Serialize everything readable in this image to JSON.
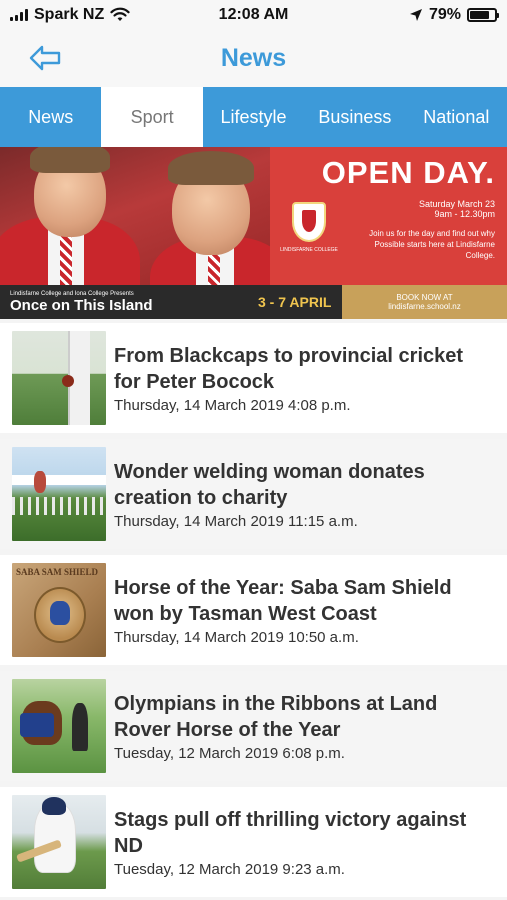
{
  "status_bar": {
    "carrier": "Spark NZ",
    "time": "12:08 AM",
    "battery_percent": "79%",
    "battery_level": 0.79
  },
  "header": {
    "title": "News",
    "back_icon": "back-arrow-icon"
  },
  "tabs": [
    {
      "label": "News",
      "active": false
    },
    {
      "label": "Sport",
      "active": true
    },
    {
      "label": "Lifestyle",
      "active": false
    },
    {
      "label": "Business",
      "active": false
    },
    {
      "label": "National",
      "active": false
    }
  ],
  "banner": {
    "headline": "OPEN DAY.",
    "date": "Saturday March 23",
    "time": "9am - 12.30pm",
    "text": "Join us for the day and find out why Possible starts here at Lindisfarne College.",
    "crest_text": "LINDISFARNE COLLEGE",
    "presenter_line": "Lindisfarne College and Iona College Presents",
    "show_title": "Once on This Island",
    "show_dates": "3 - 7 APRIL",
    "book_label": "BOOK NOW AT",
    "book_url": "lindisfarne.school.nz"
  },
  "articles": [
    {
      "title": "From Blackcaps to provincial cricket for Peter Bocock",
      "date": "Thursday, 14 March 2019 4:08 p.m.",
      "thumb_icon": "cricket-thumbnail"
    },
    {
      "title": "Wonder welding woman donates creation to charity",
      "date": "Thursday, 14 March 2019 11:15 a.m.",
      "thumb_icon": "welding-sculpture-thumbnail"
    },
    {
      "title": "Horse of the Year: Saba Sam Shield won by Tasman West Coast",
      "date": "Thursday, 14 March 2019 10:50 a.m.",
      "thumb_icon": "shield-thumbnail",
      "thumb_text": "SABA SAM SHIELD"
    },
    {
      "title": "Olympians in the Ribbons at Land Rover Horse of the Year",
      "date": "Tuesday, 12 March 2019 6:08 p.m.",
      "thumb_icon": "horse-thumbnail"
    },
    {
      "title": "Stags pull off thrilling victory against ND",
      "date": "Tuesday, 12 March 2019 9:23 a.m.",
      "thumb_icon": "cricket-batsman-thumbnail"
    }
  ],
  "colors": {
    "accent": "#3d9ad9",
    "banner_red": "#d9403b",
    "banner_gold": "#c8a15a"
  }
}
